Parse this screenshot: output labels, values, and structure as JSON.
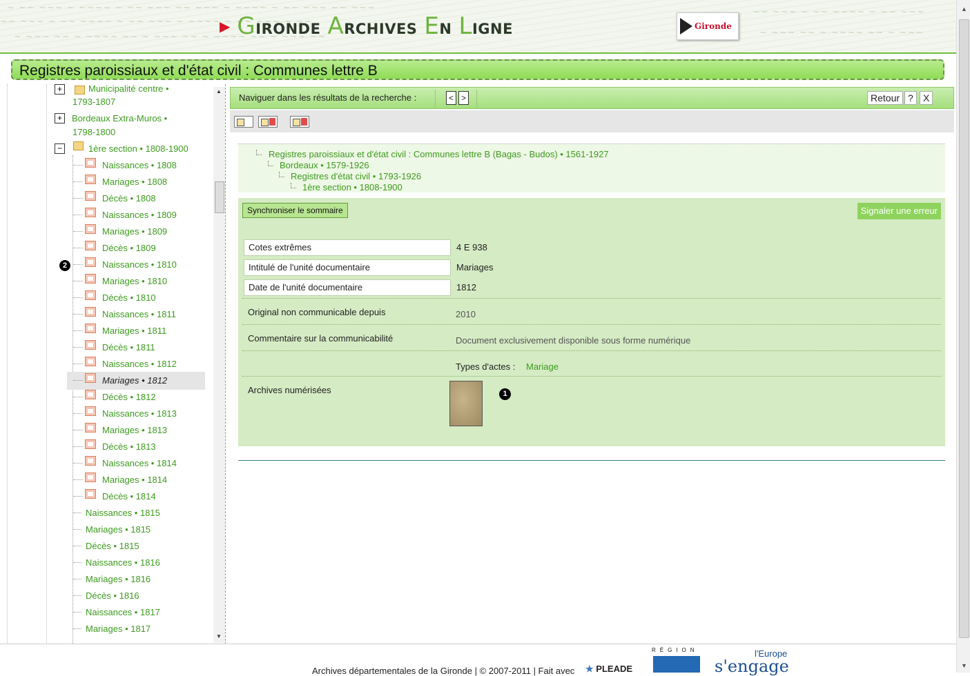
{
  "header": {
    "brand_part1_initial": "G",
    "brand_part1_rest": "IRONDE",
    "brand_part2_initial": "A",
    "brand_part2_rest": "RCHIVES",
    "brand_part3_initial": "E",
    "brand_part3_rest": "N",
    "brand_part4_initial": "L",
    "brand_part4_rest": "IGNE",
    "logo_name": "Gironde"
  },
  "page_title": "Registres paroissiaux et d'état civil : Communes lettre B",
  "tree": {
    "items": [
      {
        "label": "Municipalité centre •",
        "label2": "1793-1807"
      },
      {
        "label": "Bordeaux Extra-Muros •",
        "label2": "1798-1800"
      },
      {
        "label": "1ère section • 1808-1900"
      },
      {
        "label": "Naissances • 1808"
      },
      {
        "label": "Mariages • 1808"
      },
      {
        "label": "Décès • 1808"
      },
      {
        "label": "Naissances • 1809"
      },
      {
        "label": "Mariages • 1809"
      },
      {
        "label": "Décès • 1809"
      },
      {
        "label": "Naissances • 1810"
      },
      {
        "label": "Mariages • 1810"
      },
      {
        "label": "Décès • 1810"
      },
      {
        "label": "Naissances • 1811"
      },
      {
        "label": "Mariages • 1811"
      },
      {
        "label": "Décès • 1811"
      },
      {
        "label": "Naissances • 1812"
      },
      {
        "label": "Mariages • 1812"
      },
      {
        "label": "Décès • 1812"
      },
      {
        "label": "Naissances • 1813"
      },
      {
        "label": "Mariages • 1813"
      },
      {
        "label": "Décès • 1813"
      },
      {
        "label": "Naissances • 1814"
      },
      {
        "label": "Mariages • 1814"
      },
      {
        "label": "Décès • 1814"
      },
      {
        "label": "Naissances • 1815"
      },
      {
        "label": "Mariages • 1815"
      },
      {
        "label": "Décès • 1815"
      },
      {
        "label": "Naissances • 1816"
      },
      {
        "label": "Mariages • 1816"
      },
      {
        "label": "Décès • 1816"
      },
      {
        "label": "Naissances • 1817"
      },
      {
        "label": "Mariages • 1817"
      }
    ],
    "marker": "2"
  },
  "nav": {
    "label": "Naviguer dans les résultats de la recherche :",
    "prev": "<",
    "next": ">",
    "back": "Retour",
    "help": "?",
    "close": "X"
  },
  "breadcrumb": [
    "Registres paroissiaux et d'état civil : Communes lettre B (Bagas - Budos) • 1561-1927",
    "Bordeaux • 1579-1926",
    "Registres d'état civil • 1793-1926",
    "1ère section • 1808-1900"
  ],
  "detail": {
    "sync_label": "Synchroniser le sommaire",
    "report_label": "Signaler une erreur",
    "fields": [
      {
        "label": "Cotes extrêmes",
        "value": "4 E 938"
      },
      {
        "label": "Intitulé de l'unité documentaire",
        "value": "Mariages"
      },
      {
        "label": "Date de l'unité documentaire",
        "value": "1812"
      },
      {
        "label": "Original non communicable depuis",
        "value": "2010"
      },
      {
        "label": "Commentaire sur la communicabilité",
        "value": "Document exclusivement disponible sous forme numérique"
      }
    ],
    "types_label": "Types d'actes :",
    "types_value": "Mariage",
    "archives_label": "Archives numérisées",
    "marker": "1"
  },
  "footer": {
    "text": "Archives départementales de la Gironde | © 2007-2011 | Fait avec",
    "pleade": "PLEADE",
    "region_text": "RÉGION",
    "europe_line1": "l'Europe",
    "europe_line2": "s'engage"
  },
  "colors": {
    "accent_green": "#6fbf3c",
    "link_green": "#3d9b1e",
    "brand_red": "#d8172a"
  }
}
